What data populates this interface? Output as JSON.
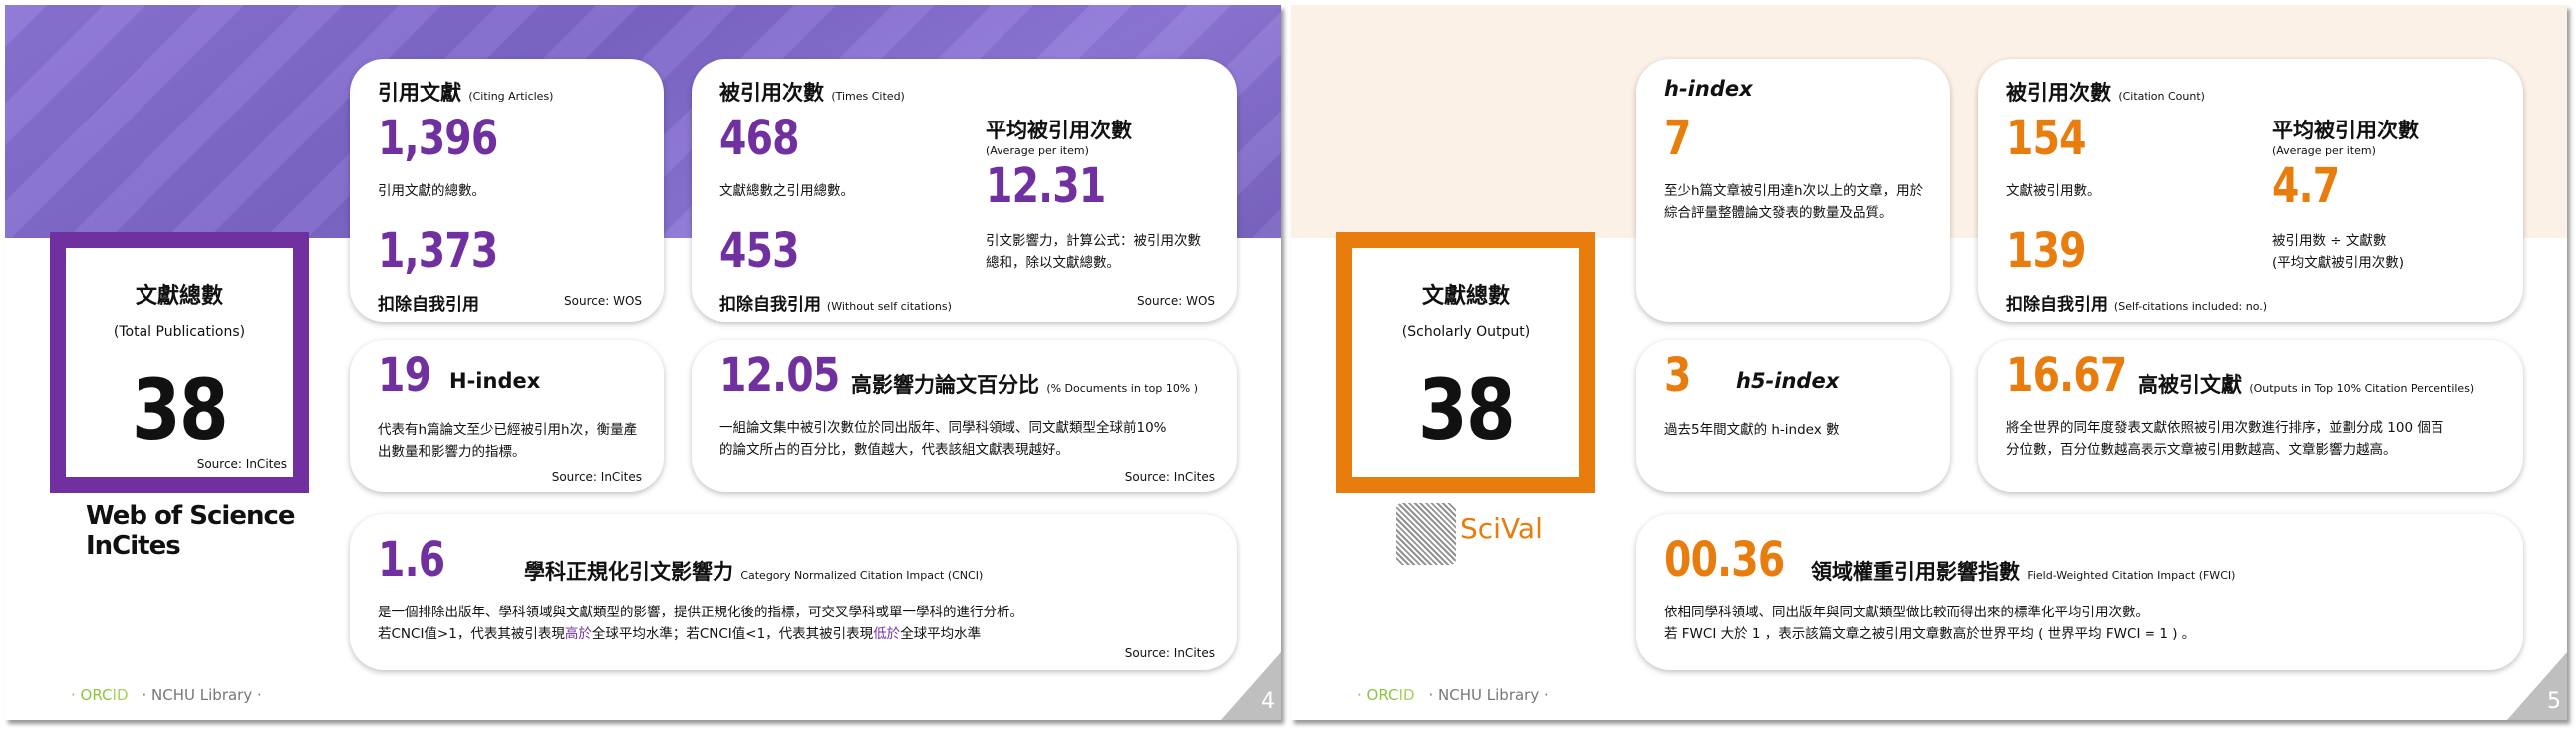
{
  "slide4": {
    "total": {
      "title": "文獻總數",
      "subtitle": "(Total Publications)",
      "value": "38",
      "source": "Source: InCites"
    },
    "citing": {
      "title": "引用文獻",
      "title_en": "(Citing Articles)",
      "value": "1,396",
      "desc": "引用文獻的總數。",
      "value2": "1,373",
      "label2": "扣除自我引用",
      "source": "Source: WOS"
    },
    "times_cited": {
      "title": "被引用次數",
      "title_en": "(Times Cited)",
      "value": "468",
      "desc": "文獻總數之引用總數。",
      "value2": "453",
      "label2": "扣除自我引用",
      "label2_en": "(Without self citations)",
      "avg_title": "平均被引用次數",
      "avg_en": "(Average  per item)",
      "avg_value": "12.31",
      "avg_desc": "引文影響力，計算公式：被引用次數總和，除以文獻總數。",
      "source": "Source: WOS"
    },
    "hindex": {
      "value": "19",
      "title": "H-index",
      "desc": "代表有h篇論文至少已經被引用h次，衡量產出數量和影響力的指標。",
      "source": "Source: InCites"
    },
    "top10": {
      "value": "12.05",
      "title": "高影響力論文百分比",
      "title_en": "(% Documents in top 10% )",
      "desc": "一組論文集中被引次數位於同出版年、同學科領域、同文獻類型全球前10%的論文所占的百分比，數值越大，代表該組文獻表現越好。",
      "source": "Source: InCites"
    },
    "cnci": {
      "value": "1.6",
      "title": "學科正規化引文影響力",
      "title_en": "Category Normalized Citation Impact  (CNCI)",
      "line1": "是一個排除出版年、學科領域與文獻類型的影響，提供正規化後的指標，可交叉學科或單一學科的進行分析。",
      "line2_a": "若CNCI值>1，代表其被引表現",
      "line2_b": "高於",
      "line2_c": "全球平均水準；若CNCI值<1，代表其被引表現",
      "line2_d": "低於",
      "line2_e": "全球平均水準",
      "source": "Source: InCites"
    },
    "logo": {
      "line1": "Web of Science",
      "line2": "InCites"
    },
    "footer": {
      "orcid_a": "ORC",
      "orcid_b": "ID",
      "library": "NCHU Library"
    },
    "page": "4"
  },
  "slide5": {
    "total": {
      "title": "文獻總數",
      "subtitle": "(Scholarly Output)",
      "value": "38"
    },
    "hindex": {
      "title": "h-index",
      "value": "7",
      "desc": "至少h篇文章被引用達h次以上的文章，用於綜合評量整體論文發表的數量及品質。"
    },
    "citation": {
      "title": "被引用次數",
      "title_en": "(Citation Count)",
      "value": "154",
      "desc": "文獻被引用數。",
      "value2": "139",
      "label2": "扣除自我引用",
      "label2_en": "(Self-citations included: no.)",
      "avg_title": "平均被引用次數",
      "avg_en": "(Average  per item)",
      "avg_value": "4.7",
      "avg_desc1": "被引用数 ÷ 文獻數",
      "avg_desc2": "(平均文獻被引用次數)"
    },
    "h5": {
      "value": "3",
      "title": "h5-index",
      "desc": "過去5年間文獻的 h-index 數"
    },
    "top10": {
      "value": "16.67",
      "title": "高被引文獻",
      "title_en": "(Outputs in Top 10% Citation Percentiles)",
      "desc": "將全世界的同年度發表文獻依照被引用次數進行排序，並劃分成 100 個百分位數，百分位數越高表示文章被引用數越高、文章影響力越高。"
    },
    "fwci": {
      "value": "00.36",
      "title": "領域權重引用影響指數",
      "title_en": "Field-Weighted Citation Impact (FWCI)",
      "line1": "依相同學科領域、同出版年與同文獻類型做比較而得出來的標準化平均引用次數。",
      "line2": "若 FWCI 大於 1 ，表示該篇文章之被引用文章數高於世界平均 ( 世界平均 FWCI = 1 ) 。"
    },
    "logo": {
      "text": "SciVal"
    },
    "footer": {
      "orcid_a": "ORC",
      "orcid_b": "ID",
      "library": "NCHU Library"
    },
    "page": "5"
  },
  "colors": {
    "wos_accent": "#7030a0",
    "scival_accent": "#e87c0c"
  }
}
